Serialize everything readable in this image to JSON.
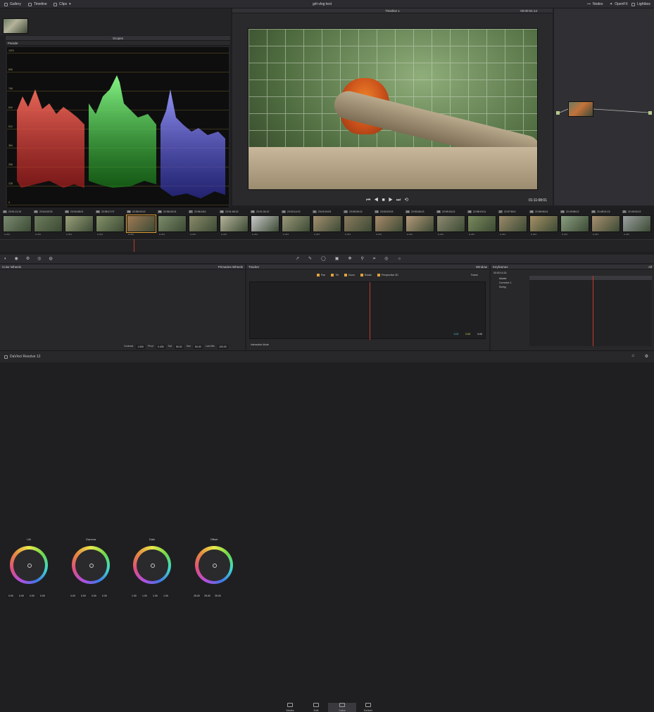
{
  "topbar": {
    "gallery": "Gallery",
    "timeline": "Timeline",
    "clips": "Clips",
    "project_title": "girl-vlog test",
    "nodes": "Nodes",
    "openfx": "OpenFX",
    "lightbox": "Lightbox"
  },
  "scopes": {
    "title": "Scopes",
    "mode": "Parade",
    "ticks": [
      "1023",
      "896",
      "768",
      "640",
      "512",
      "384",
      "256",
      "128",
      "0"
    ]
  },
  "viewer": {
    "timeline_name": "Timeline 1",
    "timecode_top": "00:00:01:14",
    "timecode": "01:11:08:01"
  },
  "clips": [
    {
      "num": "01",
      "tc": "23:01:11:10",
      "lbl": "H.264"
    },
    {
      "num": "02",
      "tc": "23:04:02:03",
      "lbl": "H.264"
    },
    {
      "num": "03",
      "tc": "23:03:48:01",
      "lbl": "H.264"
    },
    {
      "num": "04",
      "tc": "22:55:17:07",
      "lbl": "H.264"
    },
    {
      "num": "05",
      "tc": "22:55:03:13",
      "lbl": "H.264"
    },
    {
      "num": "06",
      "tc": "22:56:02:01",
      "lbl": "H.264"
    },
    {
      "num": "07",
      "tc": "22:56:18:0",
      "lbl": "H.264"
    },
    {
      "num": "08",
      "tc": "23:01:48:13",
      "lbl": "H.264"
    },
    {
      "num": "09",
      "tc": "23:01:34:12",
      "lbl": "H.264"
    },
    {
      "num": "10",
      "tc": "23:03:14:13",
      "lbl": "H.264"
    },
    {
      "num": "11",
      "tc": "23:03:19:03",
      "lbl": "H.264"
    },
    {
      "num": "12",
      "tc": "23:05:05:13",
      "lbl": "H.264"
    },
    {
      "num": "13",
      "tc": "23:00:20:03",
      "lbl": "H.264"
    },
    {
      "num": "14",
      "tc": "22:53:46:13",
      "lbl": "H.264"
    },
    {
      "num": "15",
      "tc": "22:59:18:12",
      "lbl": "H.264"
    },
    {
      "num": "16",
      "tc": "22:58:19:11",
      "lbl": "H.264"
    },
    {
      "num": "17",
      "tc": "22:57:50:0",
      "lbl": "H.264"
    },
    {
      "num": "18",
      "tc": "22:58:06:01",
      "lbl": "H.264"
    },
    {
      "num": "19",
      "tc": "22:49:58:12",
      "lbl": "H.264"
    },
    {
      "num": "20",
      "tc": "22:48:01:13",
      "lbl": "H.264"
    },
    {
      "num": "21",
      "tc": "22:49:03:12",
      "lbl": "H.264"
    }
  ],
  "color_wheels": {
    "title": "Color Wheels",
    "mode": "Primaries Wheels",
    "wheels": [
      {
        "name": "Lift",
        "vals": [
          "0.00",
          "0.00",
          "0.00",
          "0.00"
        ]
      },
      {
        "name": "Gamma",
        "vals": [
          "0.00",
          "0.00",
          "0.00",
          "0.00"
        ]
      },
      {
        "name": "Gain",
        "vals": [
          "1.00",
          "1.00",
          "1.00",
          "1.00"
        ]
      },
      {
        "name": "Offset",
        "vals": [
          "25.00",
          "25.00",
          "25.00"
        ]
      }
    ],
    "contrast_label": "Contrast",
    "contrast": "1.000",
    "pivot_label": "Pivot",
    "pivot": "0.435",
    "sat_label": "Sat",
    "sat": "50.00",
    "hue_label": "Hue",
    "hue": "50.00",
    "lum_label": "Lum Mix",
    "lum": "100.00"
  },
  "tracker": {
    "title": "Tracker",
    "mode": "Window",
    "frame": "Frame",
    "pan": "Pan",
    "tilt": "Tilt",
    "zoom": "Zoom",
    "rotate": "Rotate",
    "perspective": "Perspective 3D",
    "interactive": "Interactive Mode",
    "readouts": [
      "0.00",
      "0.00",
      "0.00"
    ]
  },
  "keyframes": {
    "title": "Keyframes",
    "filter": "All",
    "tc": "00:00:14:15",
    "master": "Master",
    "corrector": "Corrector 1",
    "sizing": "Sizing"
  },
  "bottom": {
    "app": "DaVinci Resolve 12",
    "tabs": [
      "Media",
      "Edit",
      "Color",
      "Deliver"
    ]
  }
}
